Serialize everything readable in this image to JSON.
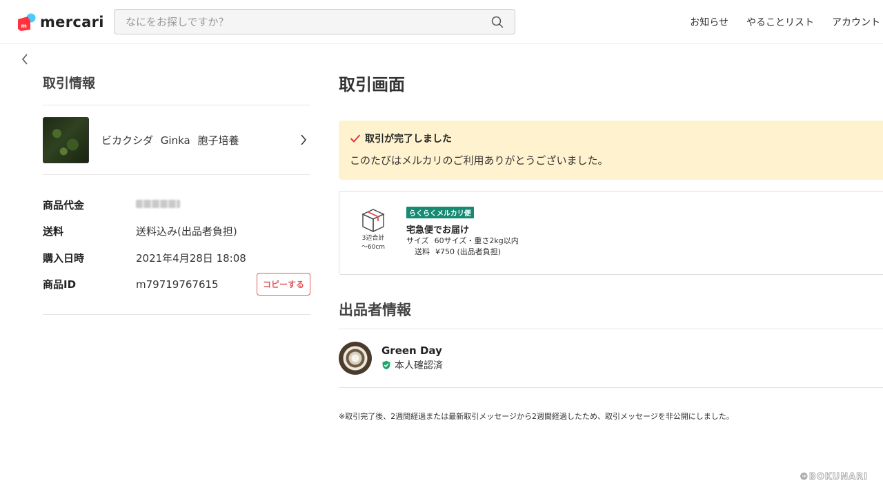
{
  "header": {
    "logo_text": "mercari",
    "search_placeholder": "なにをお探しですか？",
    "nav": [
      "お知らせ",
      "やることリスト",
      "アカウント"
    ]
  },
  "back_label": "‹",
  "left": {
    "title": "取引情報",
    "item_title": "ビカクシダ Ginka 胞子培養",
    "info": {
      "price_label": "商品代金",
      "shipping_label": "送料",
      "shipping_value": "送料込み(出品者負担)",
      "purchase_label": "購入日時",
      "purchase_value": "2021年4月28日 18:08",
      "id_label": "商品ID",
      "id_value": "m79719767615",
      "copy_label": "コピーする"
    }
  },
  "right": {
    "title": "取引画面",
    "banner": {
      "heading": "取引が完了しました",
      "message": "このたびはメルカリのご利用ありがとうございました。"
    },
    "shipping": {
      "box_caption_1": "3辺合計",
      "box_caption_2": "〜60cm",
      "badge": "らくらくメルカリ便",
      "method": "宅急便でお届け",
      "size_label": "サイズ",
      "size_value": "60サイズ・重さ2kg以内",
      "fee_label": "送料",
      "fee_value": "¥750 (出品者負担)"
    },
    "seller": {
      "title": "出品者情報",
      "name": "Green Day",
      "verified": "本人確認済"
    },
    "notice": "※取引完了後、2週間経過または最新取引メッセージから2週間経過したため、取引メッセージを非公開にしました。"
  },
  "watermark": "©BOKUNARI",
  "colors": {
    "brand_red": "#ff333f",
    "brand_blue": "#4dc9ff",
    "banner_bg": "#fff3cf",
    "copy_red": "#e05a5a",
    "rakuraku_green": "#168a73",
    "verified_green": "#1fa66a"
  }
}
